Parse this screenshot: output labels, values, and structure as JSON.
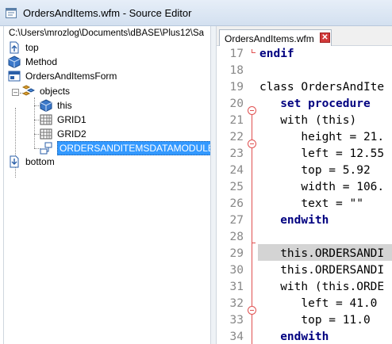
{
  "window": {
    "title": "OrdersAndItems.wfm - Source Editor"
  },
  "tree": {
    "path": "C:\\Users\\mrozlog\\Documents\\dBASE\\Plus12\\Sa",
    "items": [
      {
        "label": "top",
        "icon": "page-icon"
      },
      {
        "label": "Method",
        "icon": "cube-icon"
      },
      {
        "label": "OrdersAndItemsForm",
        "icon": "form-icon"
      },
      {
        "label": "objects",
        "icon": "objects-icon"
      },
      {
        "label": "this",
        "icon": "cube-icon"
      },
      {
        "label": "GRID1",
        "icon": "grid-icon"
      },
      {
        "label": "GRID2",
        "icon": "grid-icon"
      },
      {
        "label": "ORDERSANDITEMSDATAMODULE1",
        "icon": "datamodule-icon",
        "selected": true
      },
      {
        "label": "bottom",
        "icon": "page-icon"
      }
    ]
  },
  "editor": {
    "tab_label": "OrdersAndItems.wfm",
    "close_glyph": "✕",
    "lines": [
      {
        "num": "17",
        "text": "endif"
      },
      {
        "num": "18",
        "text": ""
      },
      {
        "num": "19",
        "text": "class OrdersAndIte"
      },
      {
        "num": "20",
        "text": "   set procedure"
      },
      {
        "num": "21",
        "text": "   with (this)"
      },
      {
        "num": "22",
        "text": "      height = 21."
      },
      {
        "num": "23",
        "text": "      left = 12.55"
      },
      {
        "num": "24",
        "text": "      top = 5.92"
      },
      {
        "num": "25",
        "text": "      width = 106."
      },
      {
        "num": "26",
        "text": "      text = \"\""
      },
      {
        "num": "27",
        "text": "   endwith"
      },
      {
        "num": "28",
        "text": ""
      },
      {
        "num": "29",
        "text": "   this.ORDERSANDI"
      },
      {
        "num": "30",
        "text": "   this.ORDERSANDI"
      },
      {
        "num": "31",
        "text": "   with (this.ORDE"
      },
      {
        "num": "32",
        "text": "      left = 41.0"
      },
      {
        "num": "33",
        "text": "      top = 11.0"
      },
      {
        "num": "34",
        "text": "   endwith"
      }
    ]
  },
  "colors": {
    "selection": "#3399ff",
    "fold": "#e05050",
    "keyword": "#000080",
    "line_highlight": "#d4d4d4"
  }
}
